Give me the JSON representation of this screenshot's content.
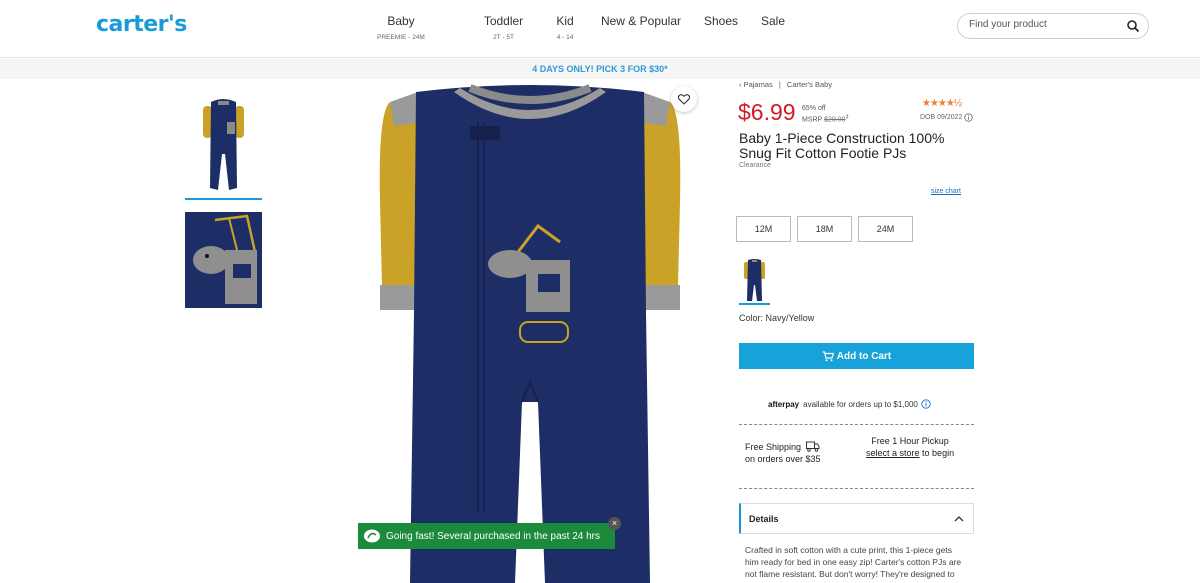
{
  "header": {
    "logo": "carter's",
    "nav": [
      {
        "label": "Baby",
        "sub": "PREEMIE - 24M"
      },
      {
        "label": "Toddler",
        "sub": "2T - 5T"
      },
      {
        "label": "Kid",
        "sub": "4 - 14"
      },
      {
        "label": "New & Popular",
        "sub": ""
      },
      {
        "label": "Shoes",
        "sub": ""
      },
      {
        "label": "Sale",
        "sub": ""
      }
    ],
    "search_placeholder": "Find your product",
    "search_icon": "magnifier-icon"
  },
  "promo": "4 DAYS ONLY! PICK 3 FOR $30*",
  "breadcrumb": [
    "‹ Pajamas",
    "Carter's Baby"
  ],
  "product": {
    "price": "$6.99",
    "discount": "65% off",
    "msrp_label": "MSRP",
    "msrp": "$20.00",
    "msrp_sup": "‡",
    "rating_stars": "★★★★½",
    "rating": 4.5,
    "dob": "DOB 09/2022",
    "title": "Baby 1-Piece Construction 100% Snug Fit Cotton Footie PJs",
    "subtitle": "Clearance",
    "size_chart": "size chart",
    "sizes": [
      "12M",
      "18M",
      "24M"
    ],
    "color_label": "Color: Navy/Yellow",
    "add_to_cart": "Add to Cart",
    "afterpay_brand": "afterpay",
    "afterpay_text": "available for orders up to $1,000",
    "shipping_title": "Free Shipping",
    "shipping_sub": "on orders over $35",
    "pickup_title": "Free 1 Hour Pickup",
    "pickup_link": "select a store",
    "pickup_tail": "to begin",
    "details_label": "Details",
    "details_text": "Crafted in soft cotton with a cute print, this 1-piece gets him ready for bed in one easy zip! Carter's cotton PJs are not flame resistant. But don't worry! They're designed to fit snugly for"
  },
  "toast": "Going fast! Several purchased in the past 24 hrs",
  "toast_close": "×",
  "colors": {
    "brand": "#1a9bd7",
    "price": "#d6192a",
    "cart": "#17a3d9",
    "toast": "#1b8a3a",
    "garment_navy": "#1d2d66",
    "garment_yellow": "#c9a227"
  }
}
